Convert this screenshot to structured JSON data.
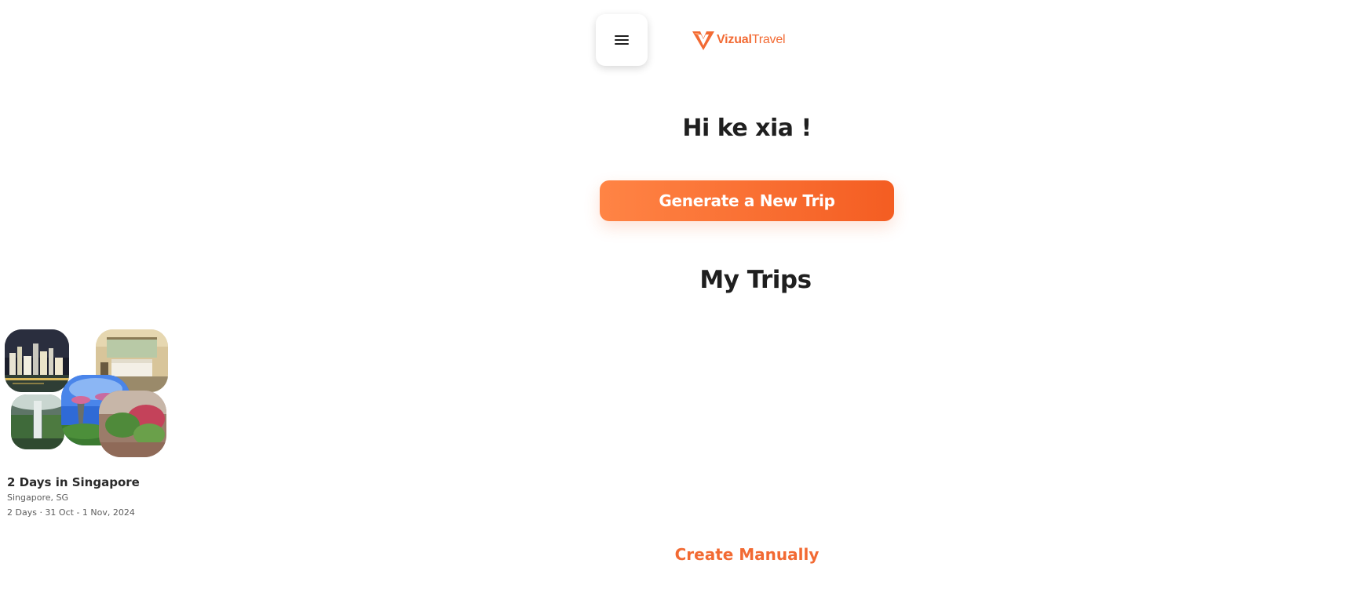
{
  "header": {
    "menu_icon": "hamburger-menu-icon",
    "logo": {
      "brand_bold": "Vizual",
      "brand_light": "Travel",
      "accent_color": "#f26a33"
    }
  },
  "greeting": "Hi ke xia !",
  "generate_button_label": "Generate a New Trip",
  "my_trips": {
    "title": "My Trips",
    "trips": [
      {
        "title": "2 Days in Singapore",
        "location": "Singapore, SG",
        "dates": "2 Days · 31 Oct - 1 Nov, 2024"
      }
    ]
  },
  "create_manually_label": "Create Manually",
  "colors": {
    "accent": "#f26a33",
    "button_gradient_start": "#ff8445",
    "button_gradient_end": "#f45d22",
    "heading": "#1f1f1f"
  }
}
